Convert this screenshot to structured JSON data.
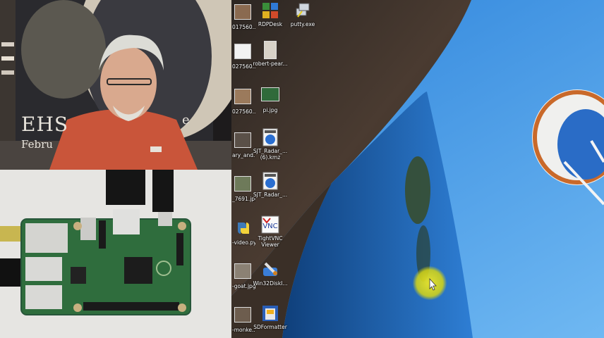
{
  "desktop_icons": [
    {
      "name": "017560....",
      "kind": "photo-icon"
    },
    {
      "name": "RDPDesk",
      "kind": "rdp-app-icon"
    },
    {
      "name": "putty.exe",
      "kind": "putty-icon"
    },
    {
      "name": "027560....",
      "kind": "blank-file-icon"
    },
    {
      "name": "robert-pear...",
      "kind": "photo-icon"
    },
    {
      "name": "027560....",
      "kind": "photo-icon"
    },
    {
      "name": "pi.jpg",
      "kind": "photo-icon"
    },
    {
      "name": "ary_and...",
      "kind": "photo-icon"
    },
    {
      "name": "SJT_Radar_...",
      "name2": "(6).kmz",
      "kind": "kmz-icon"
    },
    {
      "name": "_7691.jpg",
      "kind": "photo-icon"
    },
    {
      "name": "SJT_Radar_...",
      "kind": "kmz-icon"
    },
    {
      "name": "-video.py",
      "kind": "python-icon"
    },
    {
      "name": "TightVNC",
      "name2": "Viewer",
      "kind": "vnc-icon"
    },
    {
      "name": "-goat.jpg",
      "kind": "photo-icon"
    },
    {
      "name": "Win32DiskI...",
      "kind": "disk-imager-icon"
    },
    {
      "name": "-monke...",
      "kind": "photo-icon"
    },
    {
      "name": "SDFormatter",
      "kind": "sd-formatter-icon"
    }
  ],
  "webcam": {
    "banner_text": "EHS",
    "banner_sub": "Febru",
    "banner_right": "e"
  },
  "colors": {
    "sky": "#2e8ae0",
    "wall": "#3d3028",
    "accent": "#e8d820"
  }
}
